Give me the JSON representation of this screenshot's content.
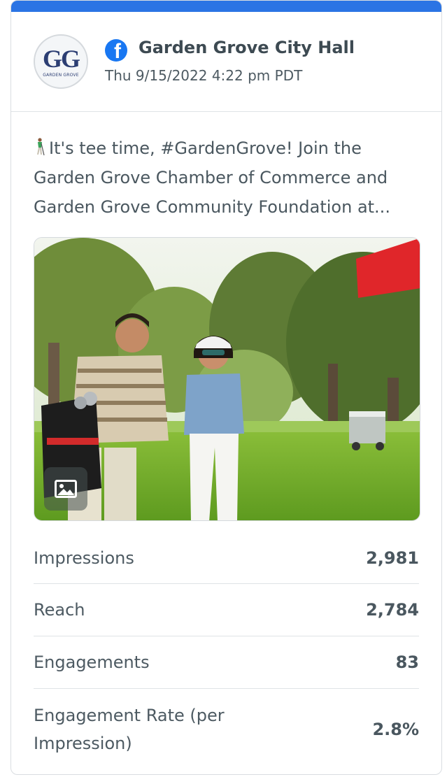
{
  "account": {
    "logo_letters": "GG",
    "logo_caption": "GARDEN GROVE",
    "name": "Garden Grove City Hall",
    "network_icon": "facebook-icon",
    "date": "Thu 9/15/2022 4:22 pm PDT"
  },
  "post": {
    "text_icon": "golfer-icon",
    "text": "It's tee time, #GardenGrove! Join the Garden Grove Chamber of Commerce and Garden Grove Community Foundation at...",
    "media_badge_icon": "image-icon"
  },
  "metrics": [
    {
      "label": "Impressions",
      "value": "2,981"
    },
    {
      "label": "Reach",
      "value": "2,784"
    },
    {
      "label": "Engagements",
      "value": "83"
    },
    {
      "label": "Engagement Rate (per Impression)",
      "value": "2.8%"
    }
  ],
  "colors": {
    "accent": "#2b74e4",
    "facebook": "#1877f2",
    "text": "#3d4a52"
  }
}
